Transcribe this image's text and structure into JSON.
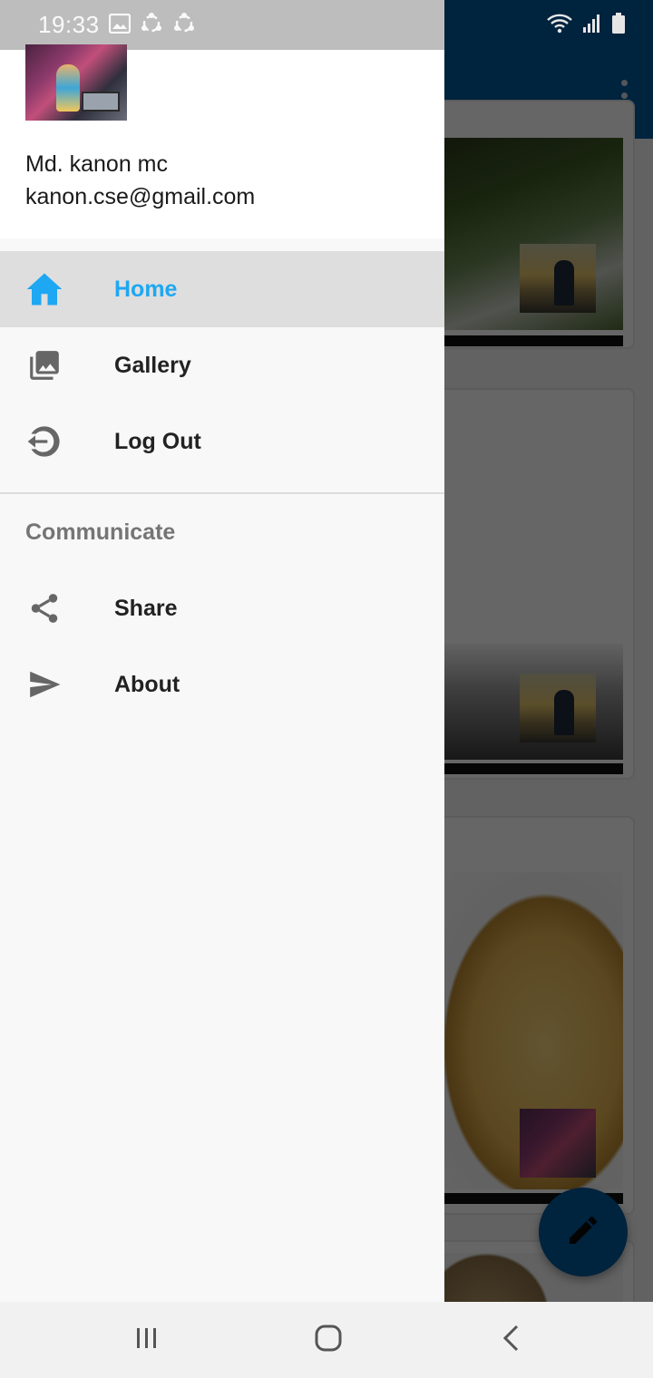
{
  "status_bar": {
    "time": "19:33",
    "left_icons": [
      "image-icon",
      "sync-icon",
      "sync-icon"
    ],
    "right_icons": [
      "wifi-icon",
      "signal-icon",
      "battery-icon"
    ]
  },
  "drawer": {
    "user": {
      "name": "Md. kanon mc",
      "email": "kanon.cse@gmail.com"
    },
    "main_items": [
      {
        "label": "Home",
        "icon": "home-icon",
        "active": true
      },
      {
        "label": "Gallery",
        "icon": "gallery-icon",
        "active": false
      },
      {
        "label": "Log Out",
        "icon": "logout-icon",
        "active": false
      }
    ],
    "section_title": "Communicate",
    "section_items": [
      {
        "label": "Share",
        "icon": "share-icon"
      },
      {
        "label": "About",
        "icon": "send-icon"
      }
    ]
  },
  "colors": {
    "app_bar": "#01579b",
    "active_item_text": "#1ea7f2",
    "active_item_background": "#dedede",
    "fab": "#01579b"
  },
  "fab": {
    "icon": "edit-icon"
  },
  "nav_bar": {
    "buttons": [
      "recents-icon",
      "home-icon",
      "back-icon"
    ]
  }
}
